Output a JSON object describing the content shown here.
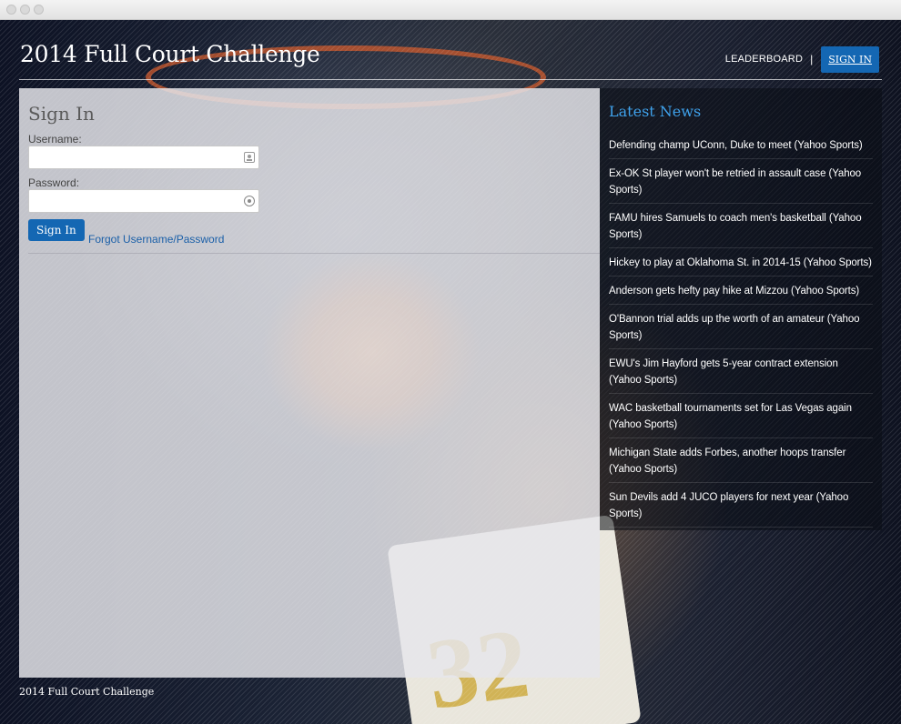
{
  "site": {
    "title": "2014 Full Court Challenge",
    "footer": "2014 Full Court Challenge"
  },
  "nav": {
    "leaderboard_label": "LEADERBOARD",
    "separator": "|",
    "signin_label": "SIGN IN"
  },
  "signin": {
    "title": "Sign In",
    "username_label": "Username:",
    "username_value": "",
    "password_label": "Password:",
    "password_value": "",
    "submit_label": "Sign In",
    "forgot_label": "Forgot Username/Password"
  },
  "news": {
    "title": "Latest News",
    "items": [
      {
        "headline": "Defending champ UConn, Duke to meet (Yahoo Sports)"
      },
      {
        "headline": "Ex-OK St player won't be retried in assault case (Yahoo Sports)"
      },
      {
        "headline": "FAMU hires Samuels to coach men's basketball (Yahoo Sports)"
      },
      {
        "headline": "Hickey to play at Oklahoma St. in 2014-15 (Yahoo Sports)"
      },
      {
        "headline": "Anderson gets hefty pay hike at Mizzou (Yahoo Sports)"
      },
      {
        "headline": "O'Bannon trial adds up the worth of an amateur (Yahoo Sports)"
      },
      {
        "headline": "EWU's Jim Hayford gets 5-year contract extension (Yahoo Sports)"
      },
      {
        "headline": "WAC basketball tournaments set for Las Vegas again (Yahoo Sports)"
      },
      {
        "headline": "Michigan State adds Forbes, another hoops transfer (Yahoo Sports)"
      },
      {
        "headline": "Sun Devils add 4 JUCO players for next year (Yahoo Sports)"
      }
    ]
  },
  "background": {
    "jersey_number": "32"
  },
  "colors": {
    "accent_blue": "#1467b3",
    "news_title": "#3fa2ec",
    "link": "#1a5fa8"
  },
  "icons": {
    "username_field": "contact-card-icon",
    "password_field": "key-icon"
  }
}
